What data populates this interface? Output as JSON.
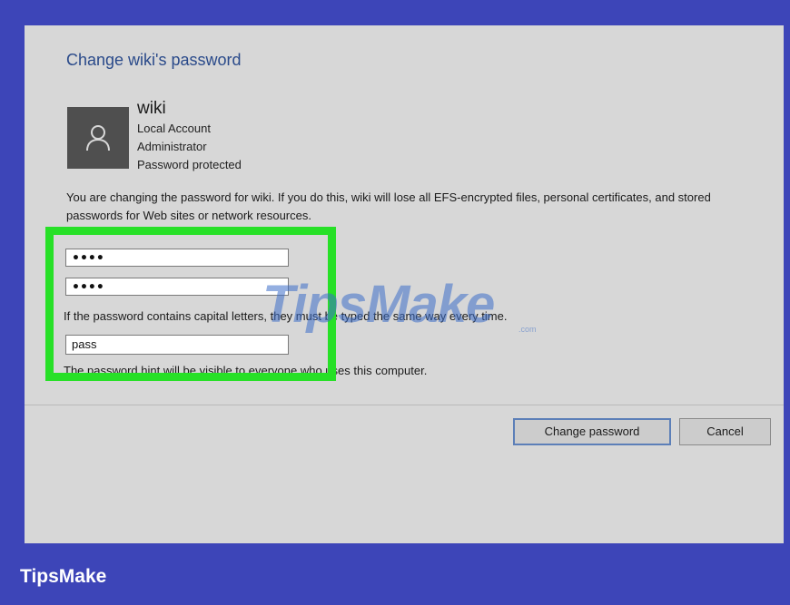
{
  "dialog": {
    "title": "Change wiki's password",
    "account": {
      "name": "wiki",
      "lines": [
        "Local Account",
        "Administrator",
        "Password protected"
      ]
    },
    "warning": "You are changing the password for wiki.  If you do this, wiki will lose all EFS-encrypted files, personal certificates, and stored passwords for Web sites or network resources.",
    "new_password": "••••",
    "confirm_password": "••••",
    "caps_note": "If the password contains capital letters, they must be typed the same way every time.",
    "hint_value": "pass",
    "hint_note": "The password hint will be visible to everyone who uses this computer.",
    "buttons": {
      "change": "Change password",
      "cancel": "Cancel"
    }
  },
  "watermark": {
    "text": "TipsMake",
    "sub": ".com"
  },
  "brand": "TipsMake",
  "colors": {
    "background": "#3d45b8",
    "dialog": "#d7d7d7",
    "highlight": "#27e027",
    "title": "#2a4a8a"
  }
}
